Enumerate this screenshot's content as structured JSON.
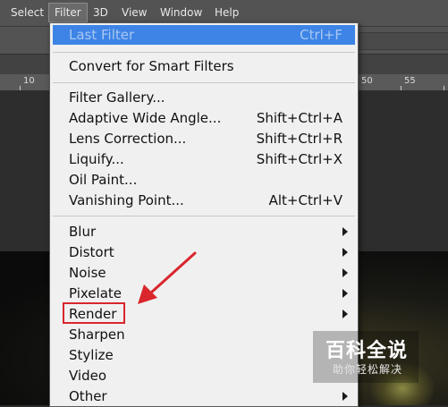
{
  "menubar": {
    "items": [
      "Select",
      "Filter",
      "3D",
      "View",
      "Window",
      "Help"
    ],
    "active": "Filter"
  },
  "ruler": {
    "labels": [
      "10",
      "50",
      "55"
    ]
  },
  "filter_menu": {
    "last_filter": {
      "label": "Last Filter",
      "shortcut": "Ctrl+F"
    },
    "convert": {
      "label": "Convert for Smart Filters"
    },
    "tools": [
      {
        "label": "Filter Gallery...",
        "shortcut": ""
      },
      {
        "label": "Adaptive Wide Angle...",
        "shortcut": "Shift+Ctrl+A"
      },
      {
        "label": "Lens Correction...",
        "shortcut": "Shift+Ctrl+R"
      },
      {
        "label": "Liquify...",
        "shortcut": "Shift+Ctrl+X"
      },
      {
        "label": "Oil Paint...",
        "shortcut": ""
      },
      {
        "label": "Vanishing Point...",
        "shortcut": "Alt+Ctrl+V"
      }
    ],
    "submenus": [
      {
        "label": "Blur",
        "has_submenu": true
      },
      {
        "label": "Distort",
        "has_submenu": true
      },
      {
        "label": "Noise",
        "has_submenu": true
      },
      {
        "label": "Pixelate",
        "has_submenu": true
      },
      {
        "label": "Render",
        "has_submenu": true
      },
      {
        "label": "Sharpen",
        "has_submenu": false
      },
      {
        "label": "Stylize",
        "has_submenu": false
      },
      {
        "label": "Video",
        "has_submenu": false
      },
      {
        "label": "Other",
        "has_submenu": true
      }
    ]
  },
  "colors": {
    "highlight": "#3d84e6",
    "annotation": "#d9262c"
  },
  "watermark": {
    "title": "百科全说",
    "subtitle": "助你轻松解决"
  }
}
